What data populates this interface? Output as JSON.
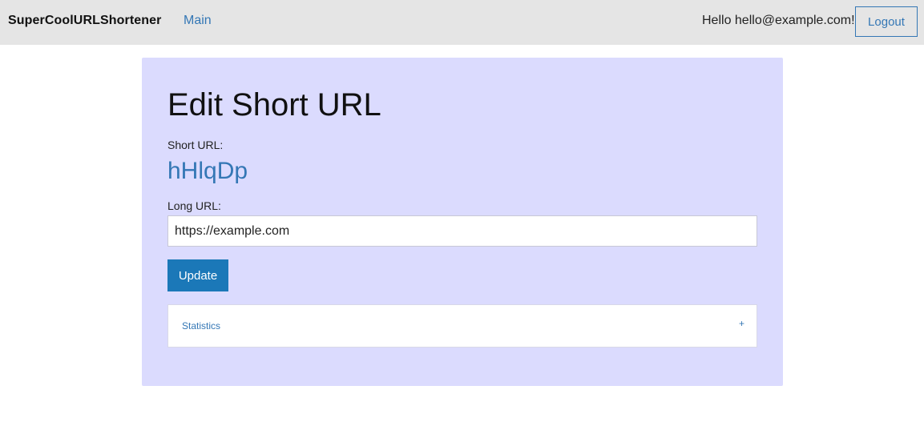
{
  "navbar": {
    "brand": "SuperCoolURLShortener",
    "main_link": "Main",
    "greeting": "Hello hello@example.com!",
    "logout_label": "Logout"
  },
  "edit": {
    "title": "Edit Short URL",
    "short_url_label": "Short URL:",
    "short_url_value": "hHlqDp",
    "long_url_label": "Long URL:",
    "long_url_value": "https://example.com",
    "update_label": "Update"
  },
  "statistics": {
    "label": "Statistics",
    "toggle_symbol": "+"
  },
  "colors": {
    "navbar_bg": "#e5e5e5",
    "card_bg": "#dbdbfe",
    "link": "#3477b5",
    "primary_button": "#1b78b8"
  }
}
